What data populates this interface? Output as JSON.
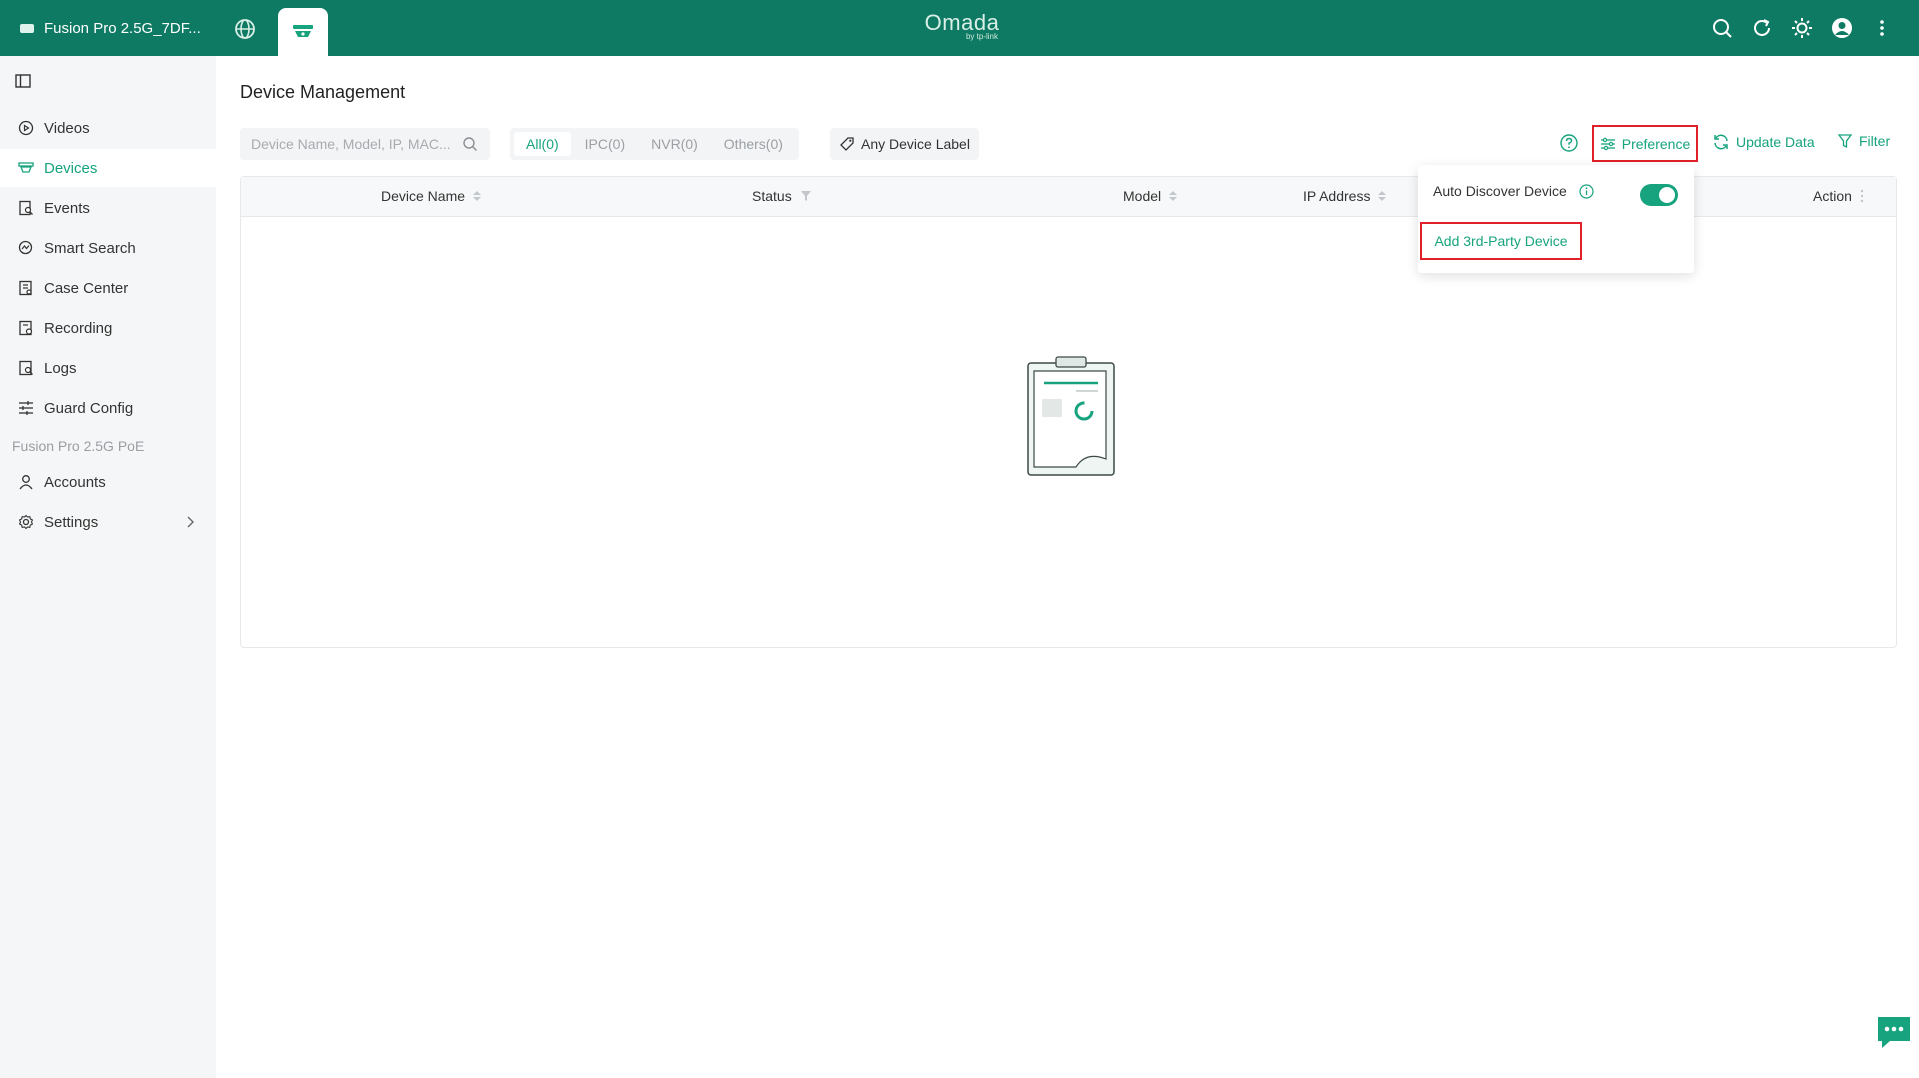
{
  "topbar": {
    "site_name": "Fusion Pro 2.5G_7DF...",
    "brand_name": "Omada",
    "brand_sub": "by tp-link"
  },
  "sidebar": {
    "items": [
      {
        "label": "Videos",
        "icon": "play-circle-icon"
      },
      {
        "label": "Devices",
        "icon": "camera-icon",
        "active": true
      },
      {
        "label": "Events",
        "icon": "event-search-icon"
      },
      {
        "label": "Smart Search",
        "icon": "smart-search-icon"
      },
      {
        "label": "Case Center",
        "icon": "case-icon"
      },
      {
        "label": "Recording",
        "icon": "recording-icon"
      },
      {
        "label": "Logs",
        "icon": "log-icon"
      },
      {
        "label": "Guard Config",
        "icon": "sliders-icon"
      }
    ],
    "section_label": "Fusion Pro 2.5G PoE",
    "items2": [
      {
        "label": "Accounts",
        "icon": "user-icon"
      },
      {
        "label": "Settings",
        "icon": "gear-icon"
      }
    ]
  },
  "main": {
    "title": "Device Management",
    "search_placeholder": "Device Name, Model, IP, MAC...",
    "tabs": [
      "All(0)",
      "IPC(0)",
      "NVR(0)",
      "Others(0)"
    ],
    "label_filter": "Any Device Label",
    "preference": "Preference",
    "update_data": "Update Data",
    "filter": "Filter",
    "columns": [
      "Device Name",
      "Status",
      "Model",
      "IP Address",
      "Action"
    ]
  },
  "dropdown": {
    "auto_discover": "Auto Discover Device",
    "auto_discover_on": true,
    "add_third_party": "Add 3rd-Party Device"
  },
  "colors": {
    "brand": "#0e7a63",
    "accent": "#16a37d",
    "highlight": "#e0202a"
  }
}
